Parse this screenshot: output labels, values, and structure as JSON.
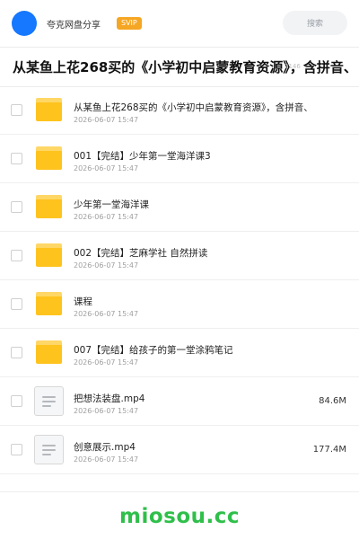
{
  "header": {
    "app_name": "夸克网盘分享",
    "badge": "SVIP",
    "search_placeholder": "搜索"
  },
  "title": {
    "text": "从某鱼上花268买的《小学初中启蒙教育资源》，含拼音、",
    "meta": "2146"
  },
  "files": [
    {
      "type": "folder",
      "name": "从某鱼上花268买的《小学初中启蒙教育资源》，含拼音、",
      "date": "2026-06-07 15:47",
      "size": ""
    },
    {
      "type": "folder",
      "name": "001【完结】少年第一堂海洋课3",
      "date": "2026-06-07 15:47",
      "size": ""
    },
    {
      "type": "folder",
      "name": "少年第一堂海洋课",
      "date": "2026-06-07 15:47",
      "size": ""
    },
    {
      "type": "folder",
      "name": "002【完结】芝麻学社 自然拼读",
      "date": "2026-06-07 15:47",
      "size": ""
    },
    {
      "type": "folder",
      "name": "课程",
      "date": "2026-06-07 15:47",
      "size": ""
    },
    {
      "type": "folder",
      "name": "007【完结】给孩子的第一堂涂鸦笔记",
      "date": "2026-06-07 15:47",
      "size": ""
    },
    {
      "type": "video",
      "name": "把想法装盘.mp4",
      "date": "2026-06-07 15:47",
      "size": "84.6M"
    },
    {
      "type": "video",
      "name": "创意展示.mp4",
      "date": "2026-06-07 15:47",
      "size": "177.4M"
    }
  ],
  "footer": {
    "brand": "miosou.cc"
  },
  "colors": {
    "avatar": "#1677ff",
    "badge": "#f5a623",
    "folder": "#ffc31e",
    "brand": "#2fbf4a"
  },
  "icons": {
    "folder": "folder-icon",
    "video": "video-file-icon"
  }
}
